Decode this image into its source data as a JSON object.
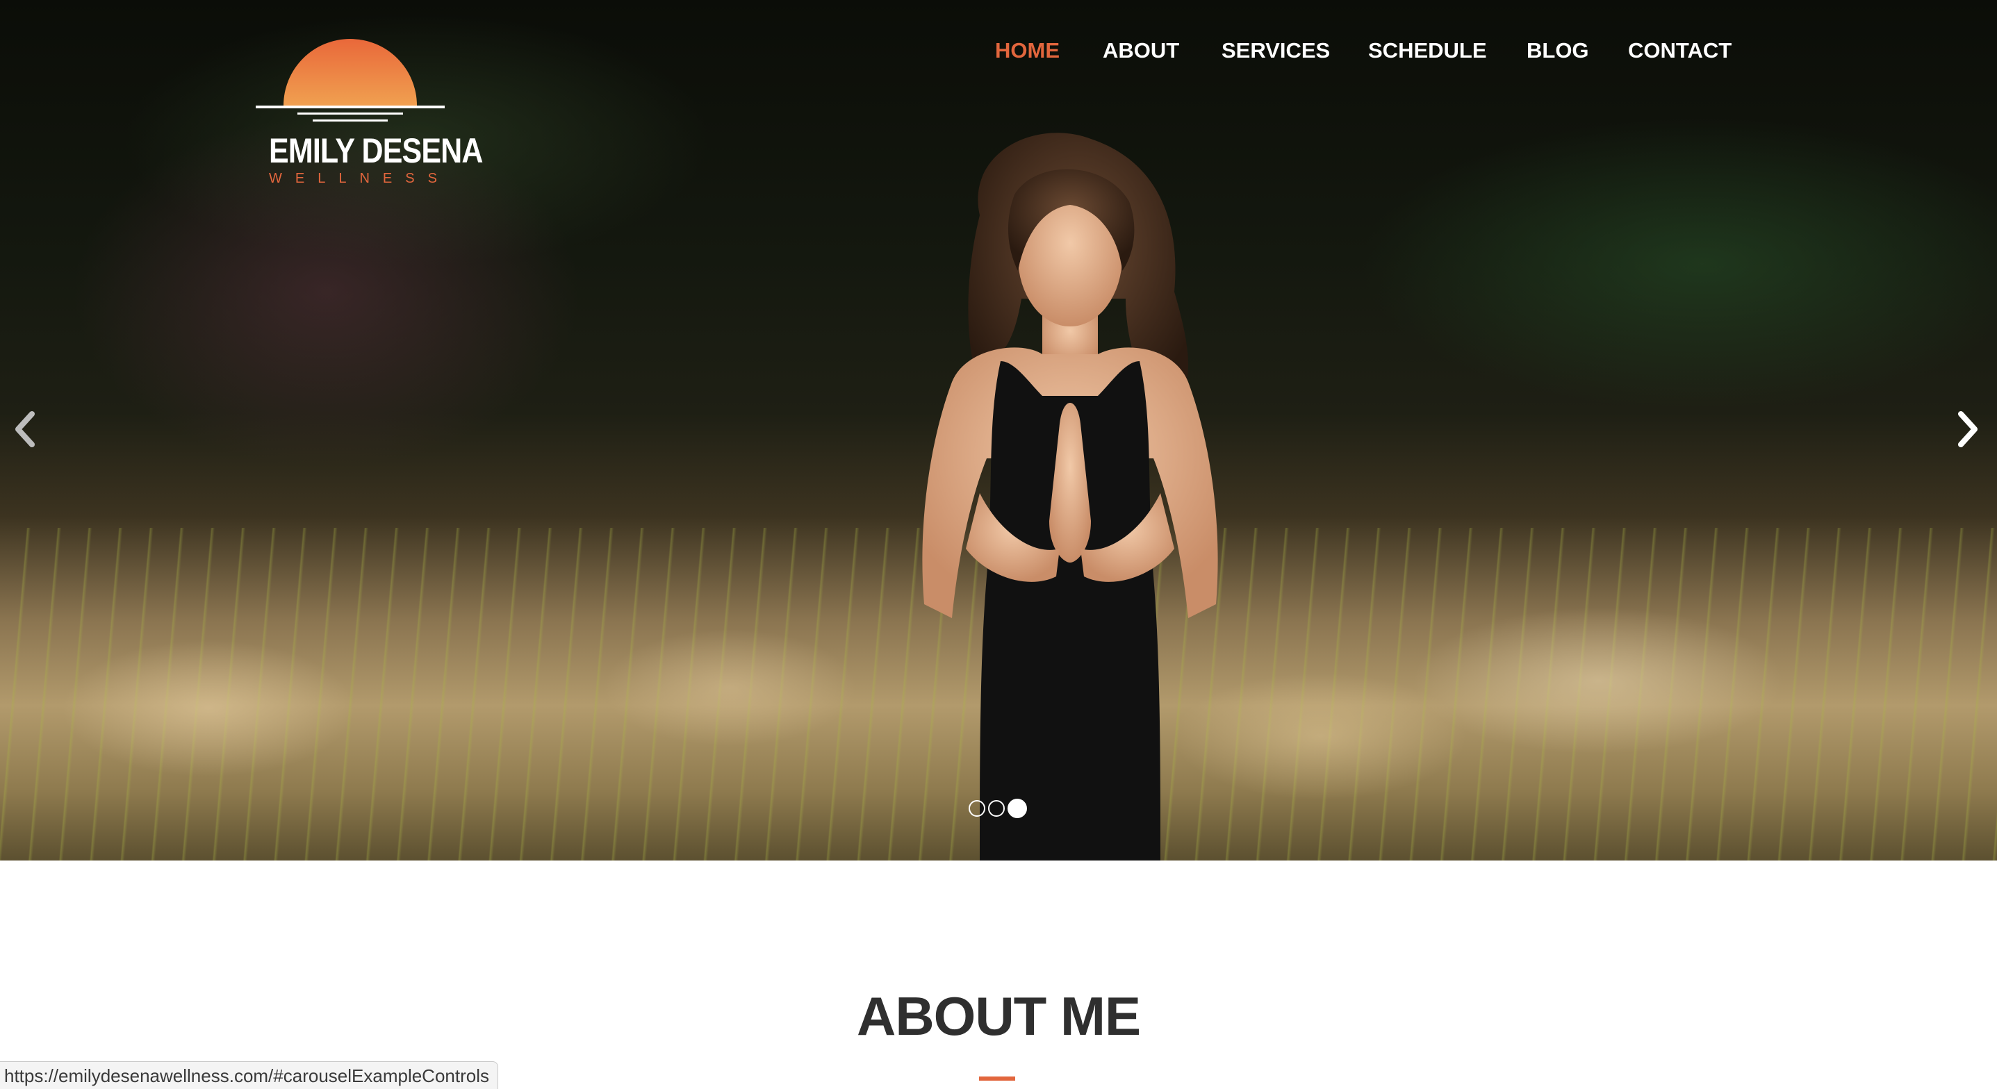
{
  "brand": {
    "name": "EMILY DESENA",
    "tagline": "WELLNESS",
    "accent_color": "#e2663d"
  },
  "nav": {
    "items": [
      {
        "label": "HOME",
        "active": true
      },
      {
        "label": "ABOUT",
        "active": false
      },
      {
        "label": "SERVICES",
        "active": false
      },
      {
        "label": "SCHEDULE",
        "active": false
      },
      {
        "label": "BLOG",
        "active": false
      },
      {
        "label": "CONTACT",
        "active": false
      }
    ]
  },
  "carousel": {
    "prev_icon": "chevron-left-icon",
    "next_icon": "chevron-right-icon",
    "slide_count": 3,
    "active_slide": 3
  },
  "about": {
    "title": "ABOUT ME"
  },
  "status_bar": {
    "url": "https://emilydesenawellness.com/#carouselExampleControls"
  }
}
